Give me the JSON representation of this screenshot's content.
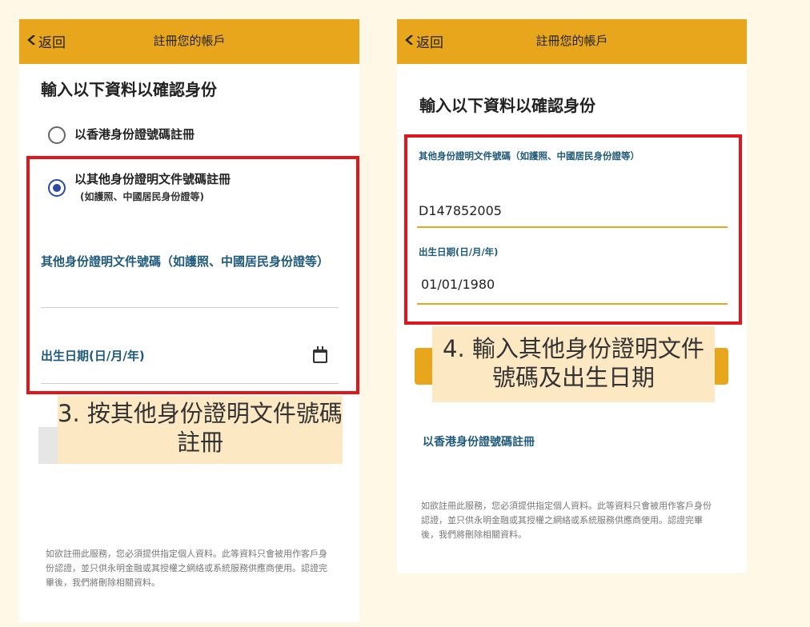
{
  "header": {
    "back_label": "返回",
    "title": "註冊您的帳戶"
  },
  "left": {
    "heading": "輸入以下資料以確認身份",
    "radio_hkid": "以香港身份證號碼註冊",
    "radio_other": "以其他身份證明文件號碼註冊",
    "radio_other_sub": "(如護照、中國居民身份證等)",
    "field_doc_label": "其他身份證明文件號碼（如護照、中國居民身份證等）",
    "field_dob_label": "出生日期(日/月/年)",
    "callout": "3. 按其他身份證明文件號碼註冊",
    "disclaimer": "如欲註冊此服務，您必須提供指定個人資料。此等資料只會被用作客戶身份認證，並只供永明金融或其授權之網絡或系統服務供應商使用。認證完畢後，我們將刪除相關資料。"
  },
  "right": {
    "heading": "輸入以下資料以確認身份",
    "field_doc_label": "其他身份證明文件號碼（如護照、中國居民身份證等）",
    "field_doc_value": "D147852005",
    "field_dob_label": "出生日期(日/月/年)",
    "field_dob_value": "01/01/1980",
    "callout": "4. 輸入其他身份證明文件號碼及出生日期",
    "hkid_link": "以香港身份證號碼註冊",
    "disclaimer": "如欲註冊此服務，您必須提供指定個人資料。此等資料只會被用作客戶身份認證，並只供永明金融或其授權之網絡或系統服務供應商使用。認證完畢後，我們將刪除相關資料。"
  },
  "colors": {
    "header": "#e8a61c",
    "highlight_box": "#e0161d",
    "callout_bg": "#fde8c4",
    "label": "#1f5a7a"
  },
  "icons": {
    "back": "chevron-left-icon",
    "calendar": "calendar-icon"
  }
}
